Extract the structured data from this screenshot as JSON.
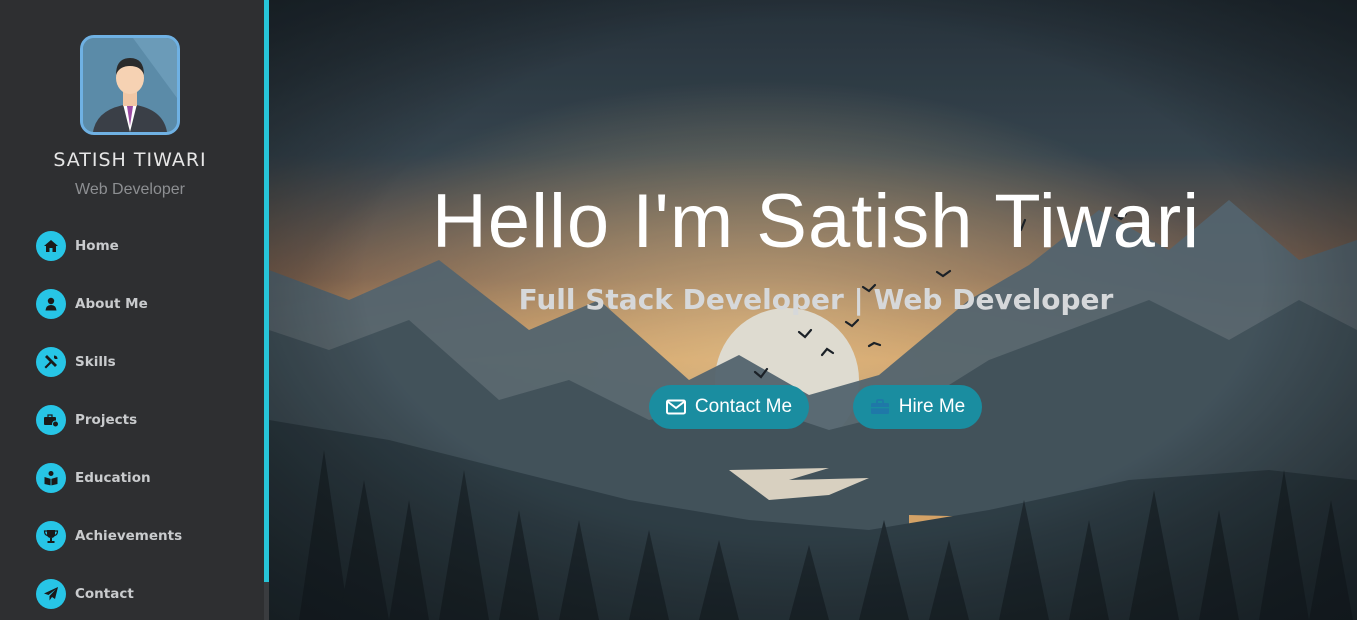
{
  "profile": {
    "name": "SATISH TIWARI",
    "role": "Web Developer"
  },
  "nav": {
    "items": [
      {
        "label": "Home",
        "icon": "home-icon"
      },
      {
        "label": "About Me",
        "icon": "user-icon"
      },
      {
        "label": "Skills",
        "icon": "tools-icon"
      },
      {
        "label": "Projects",
        "icon": "briefcase-gear-icon"
      },
      {
        "label": "Education",
        "icon": "book-reader-icon"
      },
      {
        "label": "Achievements",
        "icon": "trophy-icon"
      },
      {
        "label": "Contact",
        "icon": "paper-plane-icon"
      }
    ]
  },
  "hero": {
    "title": "Hello I'm Satish Tiwari",
    "subtitle": "Full Stack Developer | Web Developer",
    "buttons": {
      "contact_label": "Contact Me",
      "hire_label": "Hire Me"
    }
  },
  "colors": {
    "accent": "#27c5e6",
    "sidebar_bg": "#2e2f31",
    "button_bg": "#1a8da0"
  }
}
